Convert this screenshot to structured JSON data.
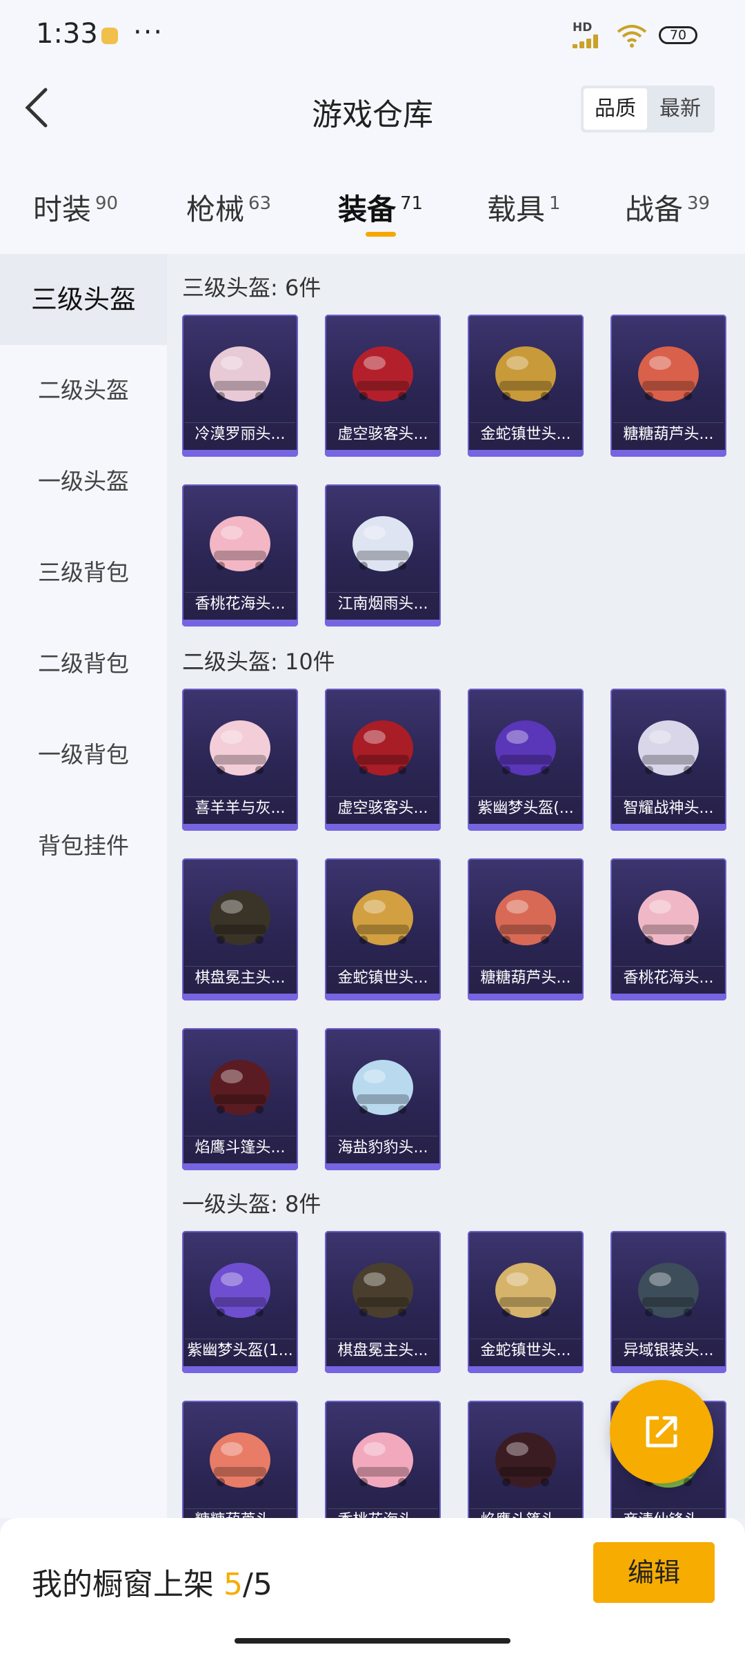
{
  "status": {
    "time": "1:33",
    "battery": "70",
    "signal": "HD"
  },
  "header": {
    "title": "游戏仓库",
    "sort_options": [
      "品质",
      "最新"
    ]
  },
  "tabs": [
    {
      "label": "时装",
      "count": "90"
    },
    {
      "label": "枪械",
      "count": "63"
    },
    {
      "label": "装备",
      "count": "71"
    },
    {
      "label": "载具",
      "count": "1"
    },
    {
      "label": "战备",
      "count": "39"
    }
  ],
  "sidebar": [
    "三级头盔",
    "二级头盔",
    "一级头盔",
    "三级背包",
    "二级背包",
    "一级背包",
    "背包挂件"
  ],
  "sections": [
    {
      "title": "三级头盔: 6件",
      "items": [
        "冷漠罗丽头...",
        "虚空骇客头...",
        "金蛇镇世头...",
        "糖糖葫芦头...",
        "香桃花海头...",
        "江南烟雨头..."
      ],
      "colors": [
        "#e8c9d6",
        "#b3202b",
        "#c99a3a",
        "#d9604a",
        "#f2b6c4",
        "#dfe4f2"
      ]
    },
    {
      "title": "二级头盔: 10件",
      "items": [
        "喜羊羊与灰...",
        "虚空骇客头...",
        "紫幽梦头盔(...",
        "智耀战神头...",
        "棋盘冕主头...",
        "金蛇镇世头...",
        "糖糖葫芦头...",
        "香桃花海头...",
        "焰鹰斗篷头...",
        "海盐豹豹头..."
      ],
      "colors": [
        "#f3cdd8",
        "#a81d26",
        "#5a36b8",
        "#d8d6e8",
        "#3a3428",
        "#d2a040",
        "#d86a55",
        "#f0b8c6",
        "#5a1c22",
        "#b9d9ef"
      ]
    },
    {
      "title": "一级头盔: 8件",
      "items": [
        "紫幽梦头盔(1...",
        "棋盘冕主头...",
        "金蛇镇世头...",
        "异域银装头...",
        "糖糖葫芦头...",
        "香桃花海头...",
        "焰鹰斗篷头...",
        "商清仙锋头..."
      ],
      "colors": [
        "#6f4ed0",
        "#4a3f2e",
        "#d6b36a",
        "#3d4d5a",
        "#e87c66",
        "#f2a9bd",
        "#3b1c22",
        "#7fb84a"
      ]
    }
  ],
  "bottom": {
    "shelf_label": "我的橱窗上架",
    "shelf_current": "5",
    "shelf_total": "/5",
    "edit": "编辑"
  }
}
